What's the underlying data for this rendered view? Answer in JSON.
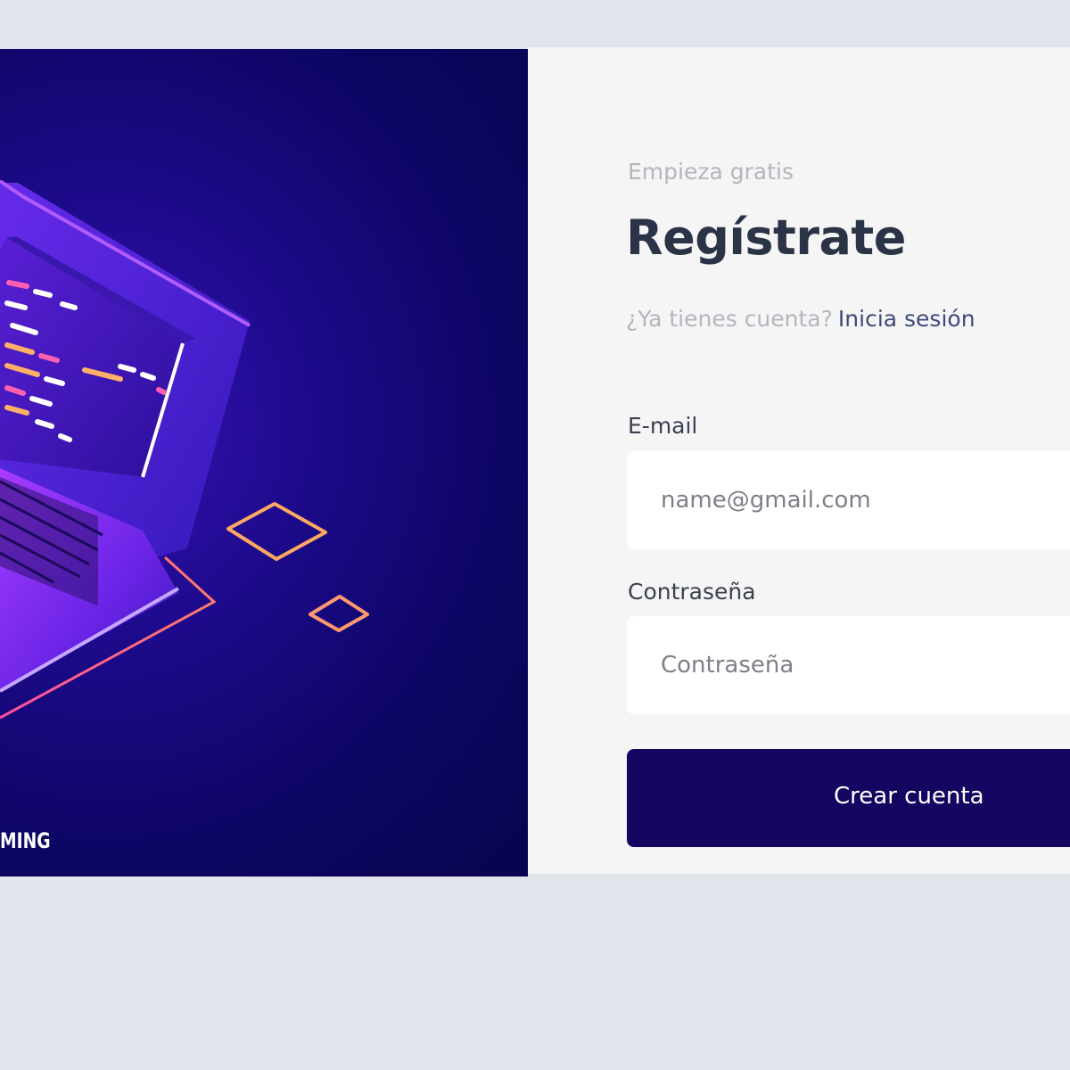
{
  "hero": {
    "caption": "MING"
  },
  "form": {
    "eyebrow": "Empieza gratis",
    "title": "Regístrate",
    "login_prompt": "¿Ya tienes cuenta?",
    "login_link": "Inicia sesión",
    "email": {
      "label": "E-mail",
      "placeholder": "name@gmail.com",
      "value": ""
    },
    "password": {
      "label": "Contraseña",
      "placeholder": "Contraseña",
      "value": ""
    },
    "submit_label": "Crear cuenta"
  },
  "colors": {
    "page_background": "#e2e4ec",
    "panel_background": "#f5f5f6",
    "hero_background": "#0c0560",
    "primary_button": "#120660",
    "title_text": "#2b3346",
    "muted_text": "#b4b6bd",
    "link_text": "#3f4a7a"
  }
}
